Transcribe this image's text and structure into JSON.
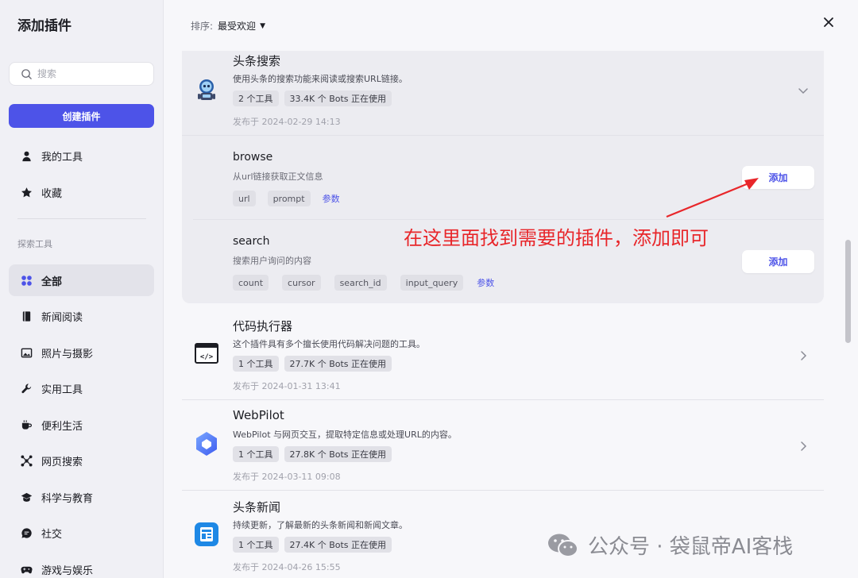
{
  "sidebar": {
    "title": "添加插件",
    "search_placeholder": "搜索",
    "create_label": "创建插件",
    "my_tools": "我的工具",
    "favorites": "收藏",
    "section_label": "探索工具",
    "categories": [
      {
        "label": "全部",
        "icon": "grid-icon",
        "active": true
      },
      {
        "label": "新闻阅读",
        "icon": "book-icon"
      },
      {
        "label": "照片与摄影",
        "icon": "image-icon"
      },
      {
        "label": "实用工具",
        "icon": "wrench-icon"
      },
      {
        "label": "便利生活",
        "icon": "cup-icon"
      },
      {
        "label": "网页搜索",
        "icon": "network-icon"
      },
      {
        "label": "科学与教育",
        "icon": "graduation-icon"
      },
      {
        "label": "社交",
        "icon": "chat-icon"
      },
      {
        "label": "游戏与娱乐",
        "icon": "gamepad-icon"
      }
    ]
  },
  "header": {
    "sort_label": "排序:",
    "sort_value": "最受欢迎"
  },
  "plugins": [
    {
      "name": "头条搜索",
      "desc": "使用头条的搜索功能来阅读或搜索URL链接。",
      "tags": [
        "2 个工具",
        "33.4K 个 Bots 正在使用"
      ],
      "date": "发布于 2024-02-29 14:13",
      "expanded": true,
      "tools": [
        {
          "name": "browse",
          "desc": "从url链接获取正文信息",
          "params": [
            "url",
            "prompt"
          ],
          "params_link": "参数",
          "add_label": "添加"
        },
        {
          "name": "search",
          "desc": "搜索用户询问的内容",
          "params": [
            "count",
            "cursor",
            "search_id",
            "input_query"
          ],
          "params_link": "参数",
          "add_label": "添加"
        }
      ]
    },
    {
      "name": "代码执行器",
      "desc": "这个插件具有多个擅长使用代码解决问题的工具。",
      "tags": [
        "1 个工具",
        "27.7K 个 Bots 正在使用"
      ],
      "date": "发布于 2024-01-31 13:41"
    },
    {
      "name": "WebPilot",
      "desc": "WebPilot 与网页交互，提取特定信息或处理URL的内容。",
      "tags": [
        "1 个工具",
        "27.8K 个 Bots 正在使用"
      ],
      "date": "发布于 2024-03-11 09:08"
    },
    {
      "name": "头条新闻",
      "desc": "持续更新，了解最新的头条新闻和新闻文章。",
      "tags": [
        "1 个工具",
        "27.4K 个 Bots 正在使用"
      ],
      "date": "发布于 2024-04-26 15:55"
    }
  ],
  "annotation": "在这里面找到需要的插件，添加即可",
  "watermark": "公众号 · 袋鼠帝AI客栈",
  "colors": {
    "accent": "#4d53e8",
    "annotation": "#e8262a"
  }
}
